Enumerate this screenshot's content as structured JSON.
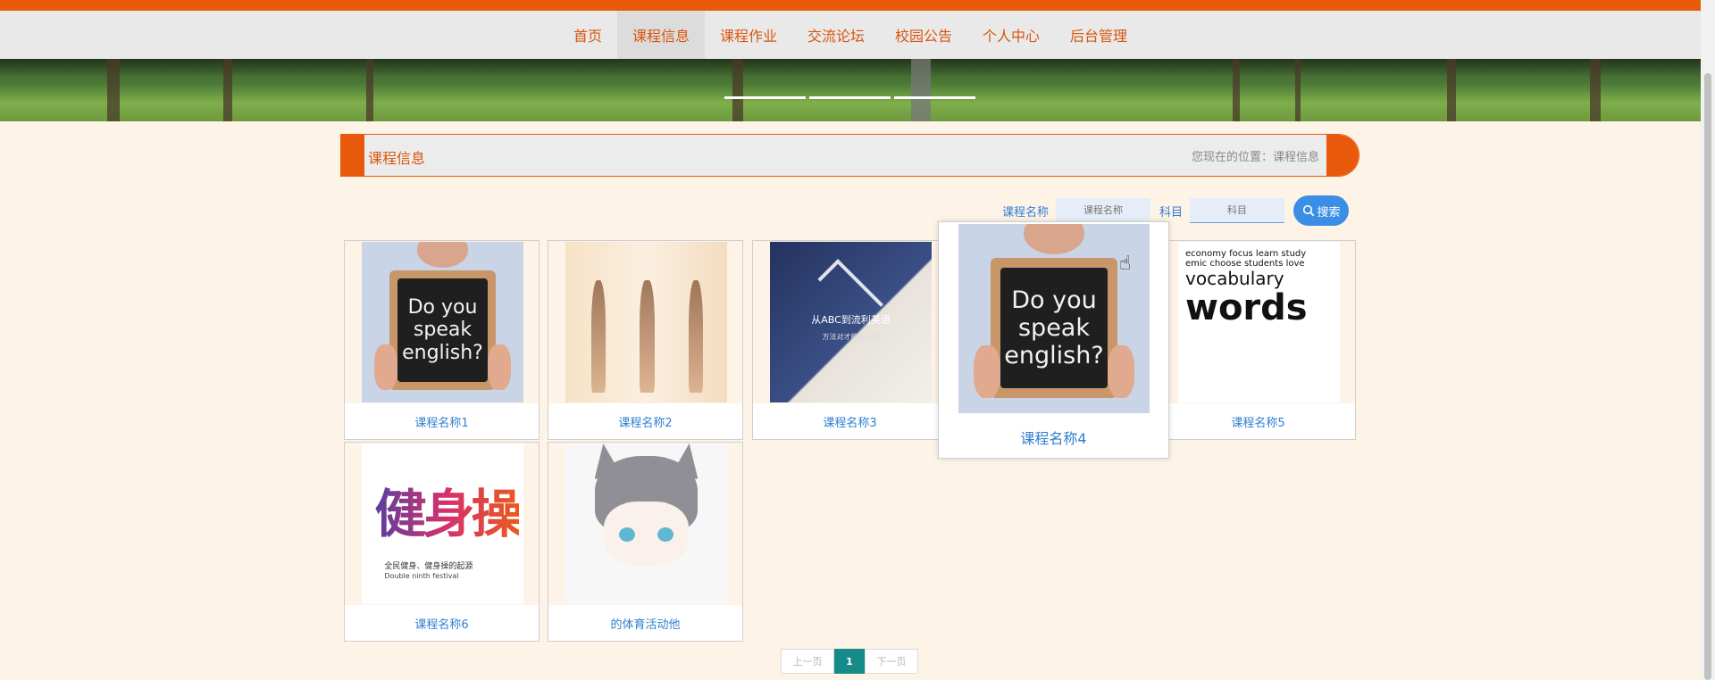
{
  "nav": {
    "items": [
      {
        "label": "首页"
      },
      {
        "label": "课程信息"
      },
      {
        "label": "课程作业"
      },
      {
        "label": "交流论坛"
      },
      {
        "label": "校园公告"
      },
      {
        "label": "个人中心"
      },
      {
        "label": "后台管理"
      }
    ],
    "active_index": 1
  },
  "banner": {
    "slide_count": 3
  },
  "breadcrumb": {
    "title": "课程信息",
    "location": "您现在的位置：课程信息"
  },
  "search": {
    "name_label": "课程名称",
    "name_placeholder": "课程名称",
    "subject_label": "科目",
    "subject_placeholder": "科目",
    "button_label": "搜索",
    "button_icon": "search-icon"
  },
  "courses": [
    {
      "name": "课程名称1",
      "image": "do-you-speak-english-board",
      "board_text": "Do you speak english?"
    },
    {
      "name": "课程名称2",
      "image": "yoga-silhouettes"
    },
    {
      "name": "课程名称3",
      "image": "abc-english-student",
      "text1": "从ABC到流利英语",
      "text2": "方法对才能提升快"
    },
    {
      "name": "课程名称4",
      "image": "do-you-speak-english-board",
      "board_text": "Do you speak english?",
      "hovered": true
    },
    {
      "name": "课程名称5",
      "image": "vocabulary-word-cloud",
      "words_big": "words",
      "words_mid": "vocabulary"
    },
    {
      "name": "课程名称6",
      "image": "fitness-calligraphy",
      "text1": "全民健身、健身操的起源",
      "text2": "Double ninth festival"
    },
    {
      "name": "的体育活动他",
      "image": "anime-cat-boy"
    }
  ],
  "pagination": {
    "prev_label": "上一页",
    "current_page": "1",
    "next_label": "下一页"
  },
  "colors": {
    "accent": "#e8590c",
    "nav_text": "#d9560d",
    "link_blue": "#2f7fd0",
    "search_button": "#3a8ee6",
    "page_active": "#168c8a",
    "page_bg": "#fdf3e7"
  }
}
